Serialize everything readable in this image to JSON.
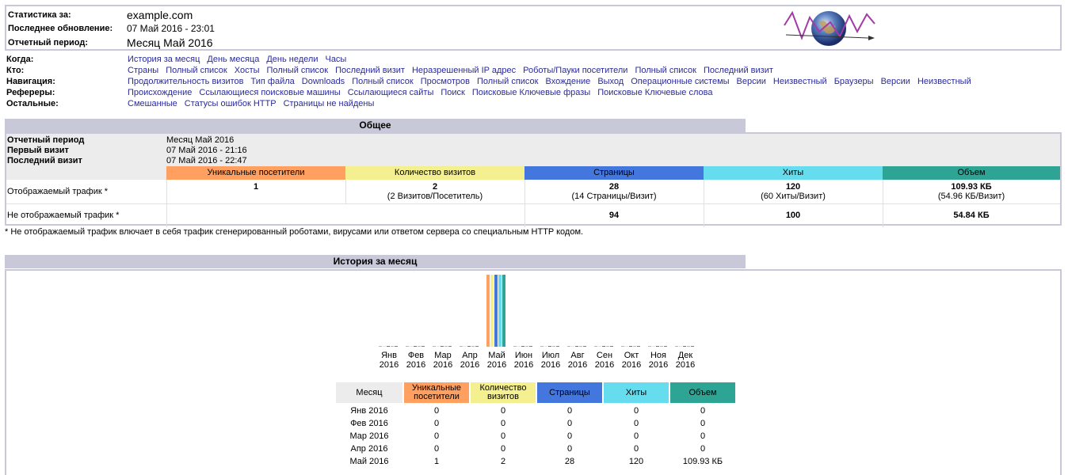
{
  "header": {
    "stats_for_label": "Статистика за:",
    "stats_for_value": "example.com",
    "last_update_label": "Последнее обновление:",
    "last_update_value": "07 Май 2016 - 23:01",
    "period_label": "Отчетный период:",
    "period_value": "Месяц Май 2016"
  },
  "nav": {
    "when": {
      "label": "Когда:",
      "links": [
        "История за месяц",
        "День месяца",
        "День недели",
        "Часы"
      ]
    },
    "who": {
      "label": "Кто:",
      "links": [
        "Страны",
        "Полный список",
        "Хосты",
        "Полный список",
        "Последний визит",
        "Неразрешенный IP адрес",
        "Роботы/Пауки посетители",
        "Полный список",
        "Последний визит"
      ]
    },
    "navigation": {
      "label": "Навигация:",
      "links": [
        "Продолжительность визитов",
        "Тип файла",
        "Downloads",
        "Полный список",
        "Просмотров",
        "Полный список",
        "Вхождение",
        "Выход",
        "Операционные системы",
        "Версии",
        "Неизвестный",
        "Браузеры",
        "Версии",
        "Неизвестный"
      ]
    },
    "referers": {
      "label": "Рефереры:",
      "links": [
        "Происхождение",
        "Ссылающиеся поисковые машины",
        "Ссылающиеся сайты",
        "Поиск",
        "Поисковые Ключевые фразы",
        "Поисковые Ключевые слова"
      ]
    },
    "other": {
      "label": "Остальные:",
      "links": [
        "Смешанные",
        "Статусы ошибок HTTP",
        "Страницы не найдены"
      ]
    }
  },
  "general": {
    "title": "Общее",
    "rows": [
      {
        "label": "Отчетный период",
        "value": "Месяц Май 2016"
      },
      {
        "label": "Первый визит",
        "value": "07 Май 2016 - 21:16"
      },
      {
        "label": "Последний визит",
        "value": "07 Май 2016 - 22:47"
      }
    ],
    "columns": [
      "Уникальные посетители",
      "Количество визитов",
      "Страницы",
      "Хиты",
      "Объем"
    ],
    "column_colors": [
      "#ffa060",
      "#f4f090",
      "#4477dd",
      "#66ddee",
      "#2ea495"
    ],
    "viewed_label": "Отображаемый трафик *",
    "viewed": {
      "unique": "1",
      "visits": "2",
      "visits_sub": "(2 Визитов/Посетитель)",
      "pages": "28",
      "pages_sub": "(14 Страницы/Визит)",
      "hits": "120",
      "hits_sub": "(60 Хиты/Визит)",
      "bandwidth": "109.93 КБ",
      "bandwidth_sub": "(54.96 КБ/Визит)"
    },
    "not_viewed_label": "Не отображаемый трафик *",
    "not_viewed": {
      "pages": "94",
      "hits": "100",
      "bandwidth": "54.84 КБ"
    },
    "note": "* Не отображаемый трафик влючает в себя трафик сгенерированный роботами, вирусами или ответом сервера со специальным HTTP кодом."
  },
  "history": {
    "title": "История за месяц",
    "months": [
      {
        "m": "Янв",
        "y": "2016"
      },
      {
        "m": "Фев",
        "y": "2016"
      },
      {
        "m": "Мар",
        "y": "2016"
      },
      {
        "m": "Апр",
        "y": "2016"
      },
      {
        "m": "Май",
        "y": "2016"
      },
      {
        "m": "Июн",
        "y": "2016"
      },
      {
        "m": "Июл",
        "y": "2016"
      },
      {
        "m": "Авг",
        "y": "2016"
      },
      {
        "m": "Сен",
        "y": "2016"
      },
      {
        "m": "Окт",
        "y": "2016"
      },
      {
        "m": "Ноя",
        "y": "2016"
      },
      {
        "m": "Дек",
        "y": "2016"
      }
    ],
    "table_headers": [
      "Месяц",
      "Уникальные посетители",
      "Количество визитов",
      "Страницы",
      "Хиты",
      "Объем"
    ],
    "table_rows": [
      [
        "Янв 2016",
        "0",
        "0",
        "0",
        "0",
        "0"
      ],
      [
        "Фев 2016",
        "0",
        "0",
        "0",
        "0",
        "0"
      ],
      [
        "Мар 2016",
        "0",
        "0",
        "0",
        "0",
        "0"
      ],
      [
        "Апр 2016",
        "0",
        "0",
        "0",
        "0",
        "0"
      ],
      [
        "Май 2016",
        "1",
        "2",
        "28",
        "120",
        "109.93 КБ"
      ]
    ]
  },
  "chart_data": {
    "type": "bar",
    "categories": [
      "Янв 2016",
      "Фев 2016",
      "Мар 2016",
      "Апр 2016",
      "Май 2016",
      "Июн 2016",
      "Июл 2016",
      "Авг 2016",
      "Сен 2016",
      "Окт 2016",
      "Ноя 2016",
      "Дек 2016"
    ],
    "series": [
      {
        "name": "Уникальные посетители",
        "color": "#ffa060",
        "values": [
          0,
          0,
          0,
          0,
          1,
          0,
          0,
          0,
          0,
          0,
          0,
          0
        ]
      },
      {
        "name": "Количество визитов",
        "color": "#f4f090",
        "values": [
          0,
          0,
          0,
          0,
          2,
          0,
          0,
          0,
          0,
          0,
          0,
          0
        ]
      },
      {
        "name": "Страницы",
        "color": "#4477dd",
        "values": [
          0,
          0,
          0,
          0,
          28,
          0,
          0,
          0,
          0,
          0,
          0,
          0
        ]
      },
      {
        "name": "Хиты",
        "color": "#66ddee",
        "values": [
          0,
          0,
          0,
          0,
          120,
          0,
          0,
          0,
          0,
          0,
          0,
          0
        ]
      },
      {
        "name": "Объем",
        "color": "#2ea495",
        "values": [
          0,
          0,
          0,
          0,
          109.93,
          0,
          0,
          0,
          0,
          0,
          0,
          0
        ]
      }
    ],
    "legend": "none",
    "grid": false
  }
}
